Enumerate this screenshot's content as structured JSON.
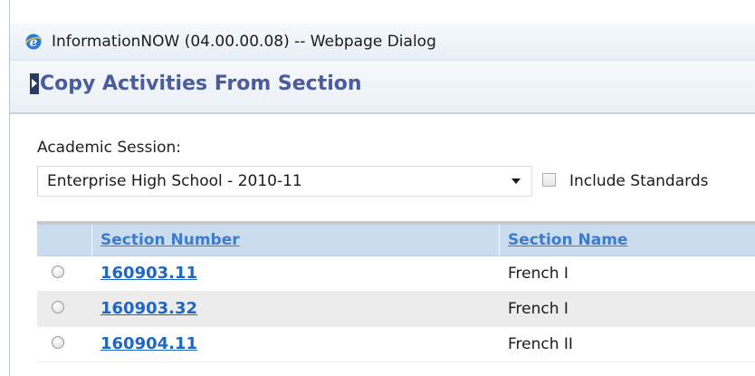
{
  "window": {
    "title": "InformationNOW (04.00.00.08) -- Webpage Dialog"
  },
  "panel": {
    "title": "Copy Activities From Section"
  },
  "form": {
    "session_label": "Academic Session:",
    "session_value": "Enterprise High School - 2010-11",
    "include_standards_label": "Include Standards",
    "include_standards_checked": false
  },
  "grid": {
    "headers": {
      "section_number": "Section Number",
      "section_name": "Section Name"
    },
    "rows": [
      {
        "section_number": "160903.11",
        "section_name": "French I"
      },
      {
        "section_number": "160903.32",
        "section_name": "French I"
      },
      {
        "section_number": "160904.11",
        "section_name": "French II"
      }
    ]
  },
  "icons": {
    "browser": "internet-explorer-icon"
  },
  "colors": {
    "header_title": "#4a5c9b",
    "grid_header_bg": "#cbdcee",
    "link": "#1f67c4"
  }
}
